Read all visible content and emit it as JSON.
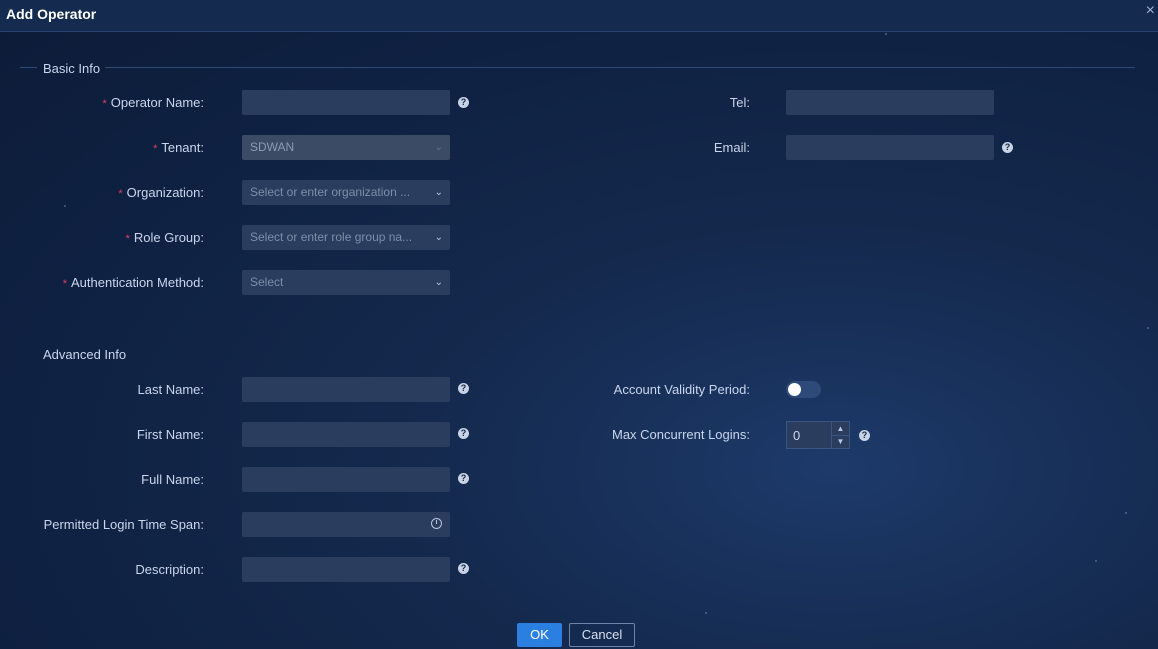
{
  "dialog": {
    "title": "Add Operator"
  },
  "basic_info": {
    "section_title": "Basic Info",
    "operator_name": {
      "label": "Operator Name:",
      "value": ""
    },
    "tenant": {
      "label": "Tenant:",
      "value": "SDWAN"
    },
    "organization": {
      "label": "Organization:",
      "placeholder": "Select or enter organization ..."
    },
    "role_group": {
      "label": "Role Group:",
      "placeholder": "Select or enter role group na..."
    },
    "auth_method": {
      "label": "Authentication Method:",
      "placeholder": "Select"
    },
    "tel": {
      "label": "Tel:",
      "value": ""
    },
    "email": {
      "label": "Email:",
      "value": ""
    }
  },
  "advanced_info": {
    "section_title": "Advanced Info",
    "last_name": {
      "label": "Last Name:",
      "value": ""
    },
    "first_name": {
      "label": "First Name:",
      "value": ""
    },
    "full_name": {
      "label": "Full Name:",
      "value": ""
    },
    "login_time_span": {
      "label": "Permitted Login Time Span:",
      "value": ""
    },
    "description": {
      "label": "Description:",
      "value": ""
    },
    "account_validity": {
      "label": "Account Validity Period:",
      "enabled": false
    },
    "max_logins": {
      "label": "Max Concurrent Logins:",
      "value": "0"
    }
  },
  "footer": {
    "ok_label": "OK",
    "cancel_label": "Cancel"
  },
  "icons": {
    "required": "*",
    "help": "?",
    "close": "×",
    "chevron": "⌄",
    "up": "▲",
    "down": "▼"
  },
  "colors": {
    "accent": "#2a7fe0",
    "required": "#e0405a",
    "background": "#0f2142"
  }
}
